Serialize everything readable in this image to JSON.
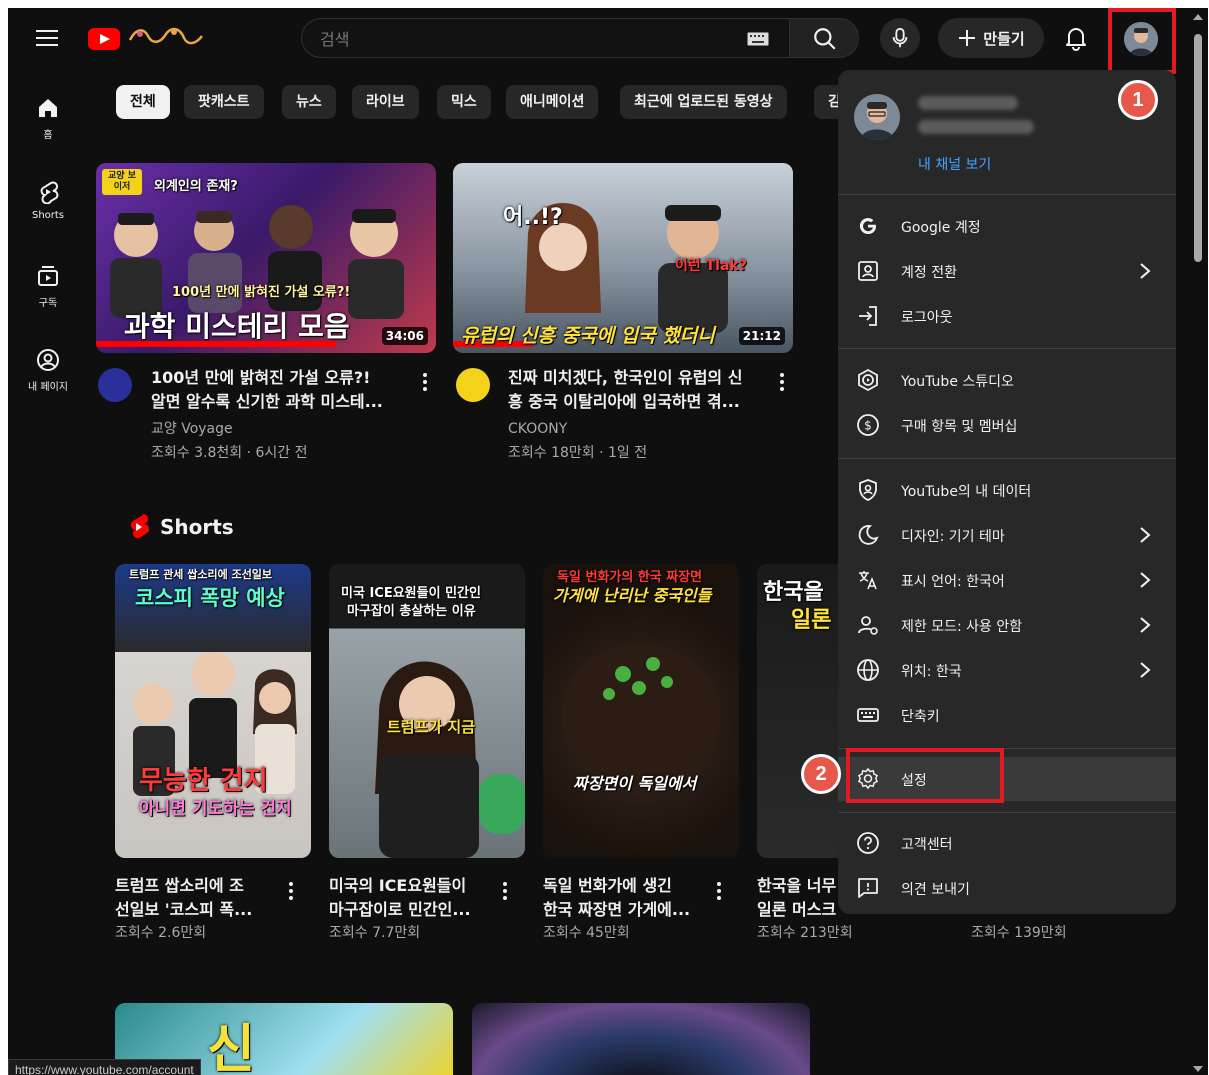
{
  "header": {
    "search_placeholder": "검색",
    "create_label": "만들기"
  },
  "nav": [
    {
      "label": "홈",
      "icon": "home-icon"
    },
    {
      "label": "Shorts",
      "icon": "shorts-icon"
    },
    {
      "label": "구독",
      "icon": "subscriptions-icon"
    },
    {
      "label": "내 페이지",
      "icon": "you-icon"
    }
  ],
  "chips": [
    "전체",
    "팟캐스트",
    "뉴스",
    "라이브",
    "믹스",
    "애니메이션",
    "최근에 업로드된 동영상",
    "김"
  ],
  "videos": [
    {
      "title_line1": "100년 만에 밝혀진 가설 오류?!",
      "title_line2": "알면 알수록 신기한 과학 미스테...",
      "channel": "교양 Voyage",
      "meta": "조회수 3.8천회 · 6시간 전",
      "duration": "34:06",
      "thumb_text_main": "과학 미스테리 모음",
      "thumb_text_sub": "100년 만에 밝혀진 가설 오류?!",
      "thumb_text_top": "외계인의 존재?",
      "thumb_badge": "교양 보이저"
    },
    {
      "title_line1": "진짜 미치겠다, 한국인이 유럽의 신",
      "title_line2": "흥 중국 이탈리아에 입국하면 겪...",
      "channel": "CKOONY",
      "meta": "조회수 18만회 · 1일 전",
      "duration": "21:12",
      "thumb_text_main": "유럽의 신흥 중국에 입국 했더니",
      "thumb_text_top": "어..!?",
      "thumb_text_tag": "이런 Tlak?"
    }
  ],
  "shorts": {
    "heading": "Shorts",
    "items": [
      {
        "title_line1": "트럼프 쌉소리에 조",
        "title_line2": "선일보 '코스피 폭...",
        "views": "조회수 2.6만회",
        "overlay_top": "트럼프 관세 쌉소리에 조선일보",
        "overlay_main": "코스피 폭망 예상",
        "overlay_bottom": "무능한 건지",
        "overlay_bottom2": "아니면 기도하는 건지"
      },
      {
        "title_line1": "미국의 ICE요원들이",
        "title_line2": "마구잡이로 민간인...",
        "views": "조회수 7.7만회",
        "overlay_top": "미국 ICE요원들이 민간인",
        "overlay_main": "마구잡이 총살하는 이유",
        "overlay_bottom": "트럼프가 지금"
      },
      {
        "title_line1": "독일 번화가에 생긴",
        "title_line2": "한국 짜장면 가게에...",
        "views": "조회수 45만회",
        "overlay_top": "독일 번화가의 한국 짜장면",
        "overlay_main": "가게에 난리난 중국인들",
        "overlay_bottom": "짜장면이 독일에서"
      },
      {
        "title_line1": "한국을 너무",
        "title_line2": "일론 머스크",
        "views": "조회수 213만회",
        "overlay_top": "한국을",
        "overlay_main": "일론"
      },
      {
        "views": "조회수 139만회"
      }
    ]
  },
  "menu": {
    "view_channel": "내 채널 보기",
    "items": [
      {
        "label": "Google 계정",
        "icon": "google-icon",
        "chevron": false
      },
      {
        "label": "계정 전환",
        "icon": "switch-account-icon",
        "chevron": true
      },
      {
        "label": "로그아웃",
        "icon": "sign-out-icon",
        "chevron": false
      },
      {
        "label": "YouTube 스튜디오",
        "icon": "studio-icon",
        "chevron": false
      },
      {
        "label": "구매 항목 및 멤버십",
        "icon": "dollar-icon",
        "chevron": false
      },
      {
        "label": "YouTube의 내 데이터",
        "icon": "data-shield-icon",
        "chevron": false
      },
      {
        "label": "디자인: 기기 테마",
        "icon": "moon-icon",
        "chevron": true
      },
      {
        "label": "표시 언어: 한국어",
        "icon": "translate-icon",
        "chevron": true
      },
      {
        "label": "제한 모드: 사용 안함",
        "icon": "restricted-icon",
        "chevron": true
      },
      {
        "label": "위치: 한국",
        "icon": "globe-icon",
        "chevron": true
      },
      {
        "label": "단축키",
        "icon": "keyboard-icon",
        "chevron": false
      },
      {
        "label": "설정",
        "icon": "gear-icon",
        "chevron": false
      },
      {
        "label": "고객센터",
        "icon": "help-icon",
        "chevron": false
      },
      {
        "label": "의견 보내기",
        "icon": "feedback-icon",
        "chevron": false
      }
    ]
  },
  "annotations": {
    "step1": "1",
    "step2": "2"
  },
  "status_url": "https://www.youtube.com/account",
  "colors": {
    "background": "#0f0f0f",
    "menu": "#282828",
    "youtube_red": "#ff0000",
    "highlight_box": "#e01b24",
    "step_badge": "#e8584a",
    "link_blue": "#3ea6ff"
  }
}
